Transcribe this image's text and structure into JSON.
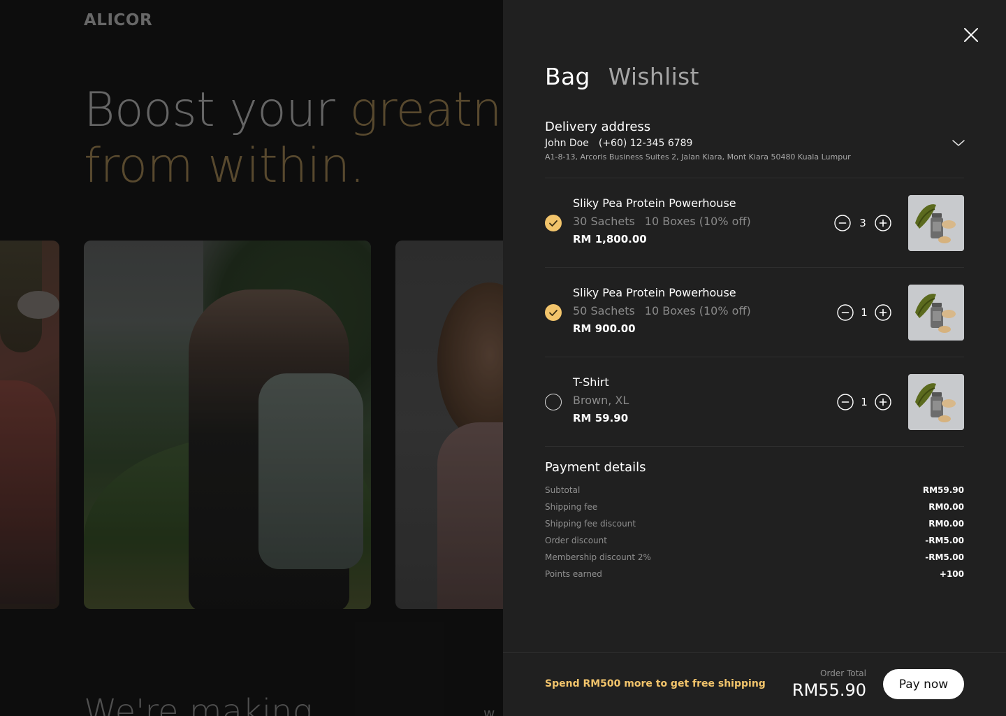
{
  "background": {
    "brand": "ALICOR",
    "hero_part1": "Boost your ",
    "hero_part2": "greatn",
    "hero_line2": "from within.",
    "bottom_text": "We're making",
    "bottom_right_text": "w"
  },
  "drawer": {
    "tabs": [
      {
        "label": "Bag",
        "active": true
      },
      {
        "label": "Wishlist",
        "active": false
      }
    ],
    "close_icon": "close-icon",
    "delivery": {
      "title": "Delivery address",
      "name": "John Doe",
      "phone": "(+60) 12-345 6789",
      "address": "A1-8-13, Arcoris Business Suites 2, Jalan Kiara, Mont Kiara 50480 Kuala Lumpur"
    },
    "items": [
      {
        "name": "Sliky Pea Protein Powerhouse",
        "variant": "30 Sachets",
        "variant2": "10 Boxes (10% off)",
        "price": "RM 1,800.00",
        "qty": "3",
        "checked": true
      },
      {
        "name": "Sliky Pea Protein Powerhouse",
        "variant": "50 Sachets",
        "variant2": "10 Boxes (10% off)",
        "price": "RM 900.00",
        "qty": "1",
        "checked": true
      },
      {
        "name": "T-Shirt",
        "variant": "Brown, XL",
        "variant2": "",
        "price": "RM 59.90",
        "qty": "1",
        "checked": false
      }
    ],
    "payment": {
      "title": "Payment details",
      "rows": [
        {
          "label": "Subtotal",
          "value": "RM59.90"
        },
        {
          "label": "Shipping fee",
          "value": "RM0.00"
        },
        {
          "label": "Shipping fee discount",
          "value": "RM0.00"
        },
        {
          "label": "Order discount",
          "value": "-RM5.00"
        },
        {
          "label": "Membership discount 2%",
          "value": "-RM5.00"
        },
        {
          "label": "Points earned",
          "value": "+100"
        }
      ]
    },
    "footer": {
      "promo": "Spend RM500 more to get free shipping",
      "total_label": "Order Total",
      "total_value": "RM55.90",
      "pay_label": "Pay now"
    }
  },
  "colors": {
    "accent": "#f2c46b",
    "hero_gold": "#7a6641",
    "drawer_bg": "#202020"
  }
}
